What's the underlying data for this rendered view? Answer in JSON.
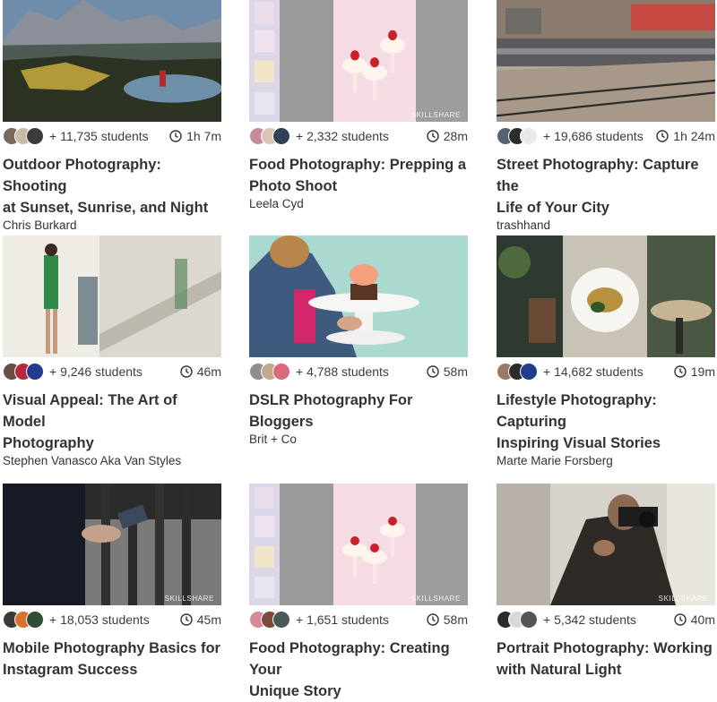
{
  "brand_watermark": "SKILLSHARE",
  "courses": [
    {
      "students": "+ 11,735 students",
      "duration": "1h 7m",
      "title_l1": "Outdoor Photography: Shooting",
      "title_l2": "at Sunset, Sunrise, and Night",
      "author": "Chris Burkard"
    },
    {
      "students": "+ 2,332 students",
      "duration": "28m",
      "title_l1": "Food Photography: Prepping a",
      "title_l2": "Photo Shoot",
      "author": "Leela Cyd"
    },
    {
      "students": "+ 19,686 students",
      "duration": "1h 24m",
      "title_l1": "Street Photography: Capture the",
      "title_l2": "Life of Your City",
      "author": "trashhand"
    },
    {
      "students": "+ 9,246 students",
      "duration": "46m",
      "title_l1": "Visual Appeal: The Art of Model",
      "title_l2": "Photography",
      "author": "Stephen Vanasco Aka Van Styles"
    },
    {
      "students": "+ 4,788 students",
      "duration": "58m",
      "title_l1": "DSLR Photography For Bloggers",
      "title_l2": "",
      "author": "Brit + Co"
    },
    {
      "students": "+ 14,682 students",
      "duration": "19m",
      "title_l1": "Lifestyle Photography: Capturing",
      "title_l2": "Inspiring Visual Stories",
      "author": "Marte Marie Forsberg"
    },
    {
      "students": "+ 18,053 students",
      "duration": "45m",
      "title_l1": "Mobile Photography Basics for",
      "title_l2": "Instagram Success",
      "author": ""
    },
    {
      "students": "+ 1,651 students",
      "duration": "58m",
      "title_l1": "Food Photography: Creating Your",
      "title_l2": "Unique Story",
      "author": ""
    },
    {
      "students": "+ 5,342 students",
      "duration": "40m",
      "title_l1": "Portrait Photography: Working",
      "title_l2": "with Natural Light",
      "author": ""
    }
  ],
  "colors": {
    "title": "#333333",
    "meta": "#3c3c3c",
    "watermark": "#ffffff"
  }
}
